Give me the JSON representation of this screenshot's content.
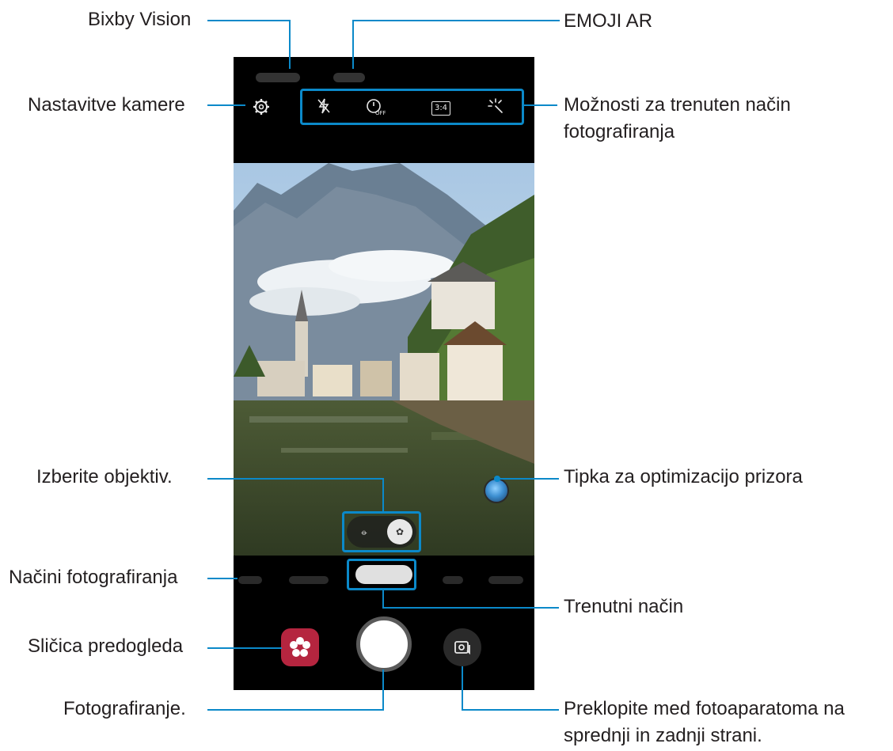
{
  "labels": {
    "bixby_vision": "Bixby Vision",
    "emoji_ar": "EMOJI AR",
    "camera_settings": "Nastavitve kamere",
    "current_mode_options": "Možnosti za trenuten način fotografiranja",
    "select_lens": "Izberite objektiv.",
    "scene_optimizer": "Tipka za optimizacijo prizora",
    "shooting_modes": "Načini fotografiranja",
    "current_mode": "Trenutni način",
    "preview_thumbnail": "Sličica predogleda",
    "take_picture": "Fotografiranje.",
    "switch_cameras": "Preklopite med fotoaparatoma na sprednji in zadnji strani."
  },
  "options": {
    "flash": "⚡",
    "timer": "OFF",
    "ratio": "3:4",
    "effects": "✨"
  },
  "colors": {
    "callout": "#0b89c9",
    "gallery_thumb": "#b5253f",
    "scene_button": "#3d8fd1"
  },
  "icons": {
    "settings": "gear-icon",
    "flash": "flash-off-icon",
    "timer": "timer-off-icon",
    "ratio": "ratio-icon",
    "effects": "sparkle-icon",
    "lens_wide": "lens-wide-icon",
    "lens_main": "lens-main-icon",
    "preview": "flower-icon",
    "switch": "switch-camera-icon"
  }
}
